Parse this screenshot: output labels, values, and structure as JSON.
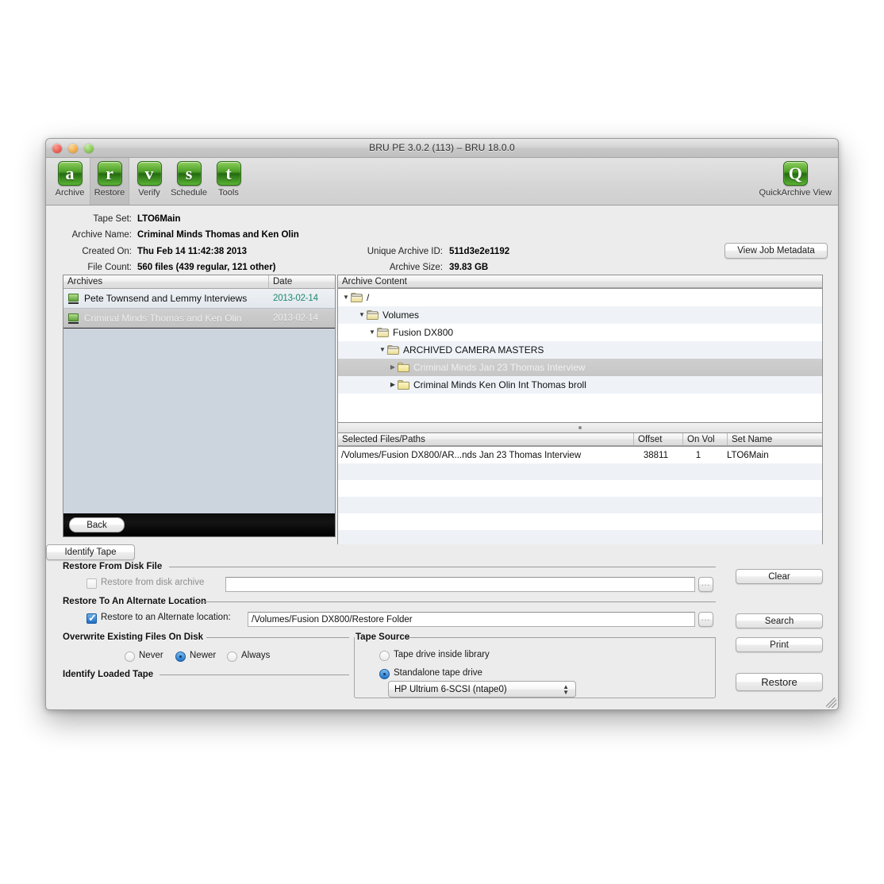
{
  "window": {
    "title": "BRU PE 3.0.2 (113) – BRU 18.0.0",
    "traffic": {
      "close": "close-button",
      "minimize": "minimize-button",
      "zoom": "zoom-button"
    }
  },
  "toolbar": {
    "items": [
      {
        "glyph": "a",
        "label": "Archive",
        "selected": false
      },
      {
        "glyph": "r",
        "label": "Restore",
        "selected": true
      },
      {
        "glyph": "v",
        "label": "Verify",
        "selected": false
      },
      {
        "glyph": "s",
        "label": "Schedule",
        "selected": false
      },
      {
        "glyph": "t",
        "label": "Tools",
        "selected": false
      }
    ],
    "quick_archive": {
      "glyph": "Q",
      "label": "QuickArchive View"
    }
  },
  "info": {
    "tape_set_label": "Tape Set:",
    "tape_set_value": "LTO6Main",
    "archive_name_label": "Archive Name:",
    "archive_name_value": "Criminal Minds Thomas and Ken Olin",
    "created_on_label": "Created On:",
    "created_on_value": "Thu Feb 14 11:42:38 2013",
    "file_count_label": "File Count:",
    "file_count_value": "560 files (439 regular, 121 other)",
    "unique_id_label": "Unique Archive ID:",
    "unique_id_value": "511d3e2e1192",
    "archive_size_label": "Archive Size:",
    "archive_size_value": "39.83 GB",
    "view_job_metadata": "View Job Metadata"
  },
  "archives": {
    "columns": {
      "name": "Archives",
      "date": "Date"
    },
    "rows": [
      {
        "name": "Pete Townsend and Lemmy Interviews",
        "date": "2013-02-14",
        "selected": false
      },
      {
        "name": "Criminal Minds Thomas and Ken Olin",
        "date": "2013-02-14",
        "selected": true
      }
    ],
    "back_button": "Back"
  },
  "archive_content": {
    "header": "Archive Content",
    "rows": [
      {
        "label": "/",
        "depth": 0,
        "twisty": "down",
        "icon": "open-folder-icon",
        "selected": false
      },
      {
        "label": "Volumes",
        "depth": 1,
        "twisty": "down",
        "icon": "open-folder-icon",
        "selected": false
      },
      {
        "label": "Fusion DX800",
        "depth": 2,
        "twisty": "down",
        "icon": "open-folder-icon",
        "selected": false
      },
      {
        "label": "ARCHIVED CAMERA MASTERS",
        "depth": 3,
        "twisty": "down",
        "icon": "open-folder-icon",
        "selected": false
      },
      {
        "label": "Criminal Minds Jan 23 Thomas Interview",
        "depth": 4,
        "twisty": "right",
        "icon": "folder-icon",
        "selected": true
      },
      {
        "label": "Criminal Minds Ken Olin Int Thomas broll",
        "depth": 4,
        "twisty": "right",
        "icon": "folder-icon",
        "selected": false
      }
    ]
  },
  "selected_files": {
    "columns": {
      "path": "Selected Files/Paths",
      "offset": "Offset",
      "on_vol": "On Vol",
      "set_name": "Set Name"
    },
    "rows": [
      {
        "path": "/Volumes/Fusion DX800/AR...nds Jan 23 Thomas Interview",
        "offset": "38811",
        "on_vol": "1",
        "set_name": "LTO6Main"
      }
    ]
  },
  "restore_from_disk": {
    "group_title": "Restore From Disk File",
    "checkbox_label": "Restore from disk archive",
    "checked": false,
    "path_value": "",
    "browse_label": "..."
  },
  "alternate_location": {
    "group_title": "Restore To An Alternate Location",
    "checkbox_label": "Restore to an Alternate location:",
    "checked": true,
    "path_value": "/Volumes/Fusion DX800/Restore Folder",
    "browse_label": "..."
  },
  "overwrite": {
    "group_title": "Overwrite Existing Files On Disk",
    "options": [
      {
        "label": "Never",
        "selected": false
      },
      {
        "label": "Newer",
        "selected": true
      },
      {
        "label": "Always",
        "selected": false
      }
    ]
  },
  "identify": {
    "group_title": "Identify Loaded Tape",
    "button_label": "Identify Tape"
  },
  "tape_source": {
    "group_title": "Tape Source",
    "options": [
      {
        "label": "Tape drive inside library",
        "selected": false
      },
      {
        "label": "Standalone tape drive",
        "selected": true
      }
    ],
    "drive_selected": "HP Ultrium 6-SCSI (ntape0)"
  },
  "action_buttons": {
    "clear": "Clear",
    "search": "Search",
    "print": "Print",
    "restore": "Restore"
  },
  "colors": {
    "accent_green": "#4ea028",
    "date_green": "#1d8a6e",
    "selection_blue": "#2272c4",
    "window_bg": "#ececec"
  }
}
